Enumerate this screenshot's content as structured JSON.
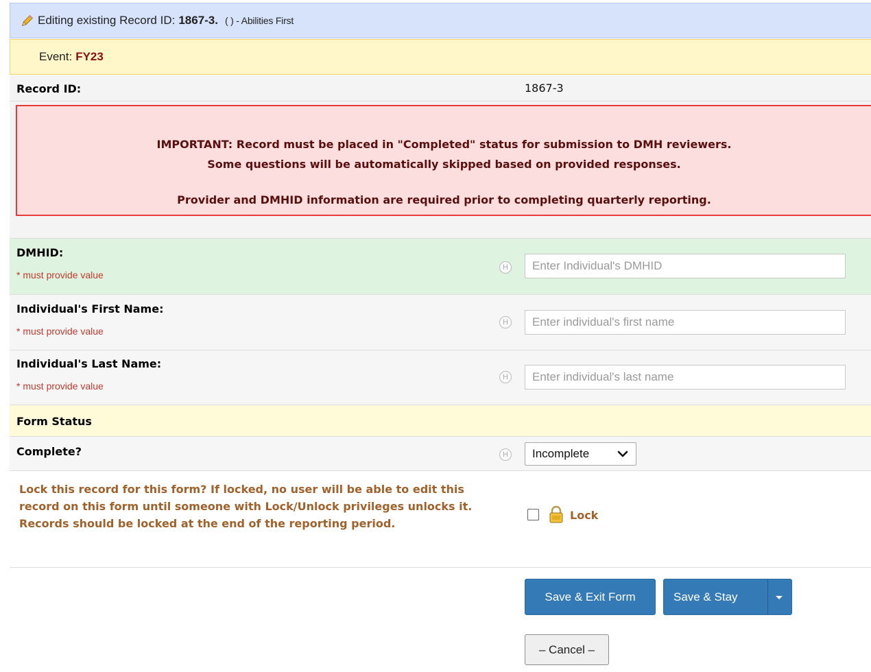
{
  "header": {
    "editing_prefix": "Editing existing Record ID:",
    "record_id": "1867-3.",
    "org_suffix": "( ) - Abilities First",
    "icon": "pencil-icon"
  },
  "event": {
    "label": "Event:",
    "value": "FY23"
  },
  "record_row": {
    "label": "Record ID:",
    "value": "1867-3"
  },
  "alert": {
    "line1": "IMPORTANT: Record must be placed in \"Completed\" status for submission to DMH reviewers.",
    "line2": "Some questions will be automatically skipped based on provided responses.",
    "line3": "Provider and DMHID information are required prior to completing quarterly reporting."
  },
  "fields": [
    {
      "label": "DMHID:",
      "required_note": "* must provide value",
      "placeholder": "Enter Individual's DMHID",
      "help_icon": "H"
    },
    {
      "label": "Individual's First Name:",
      "required_note": "* must provide value",
      "placeholder": "Enter individual's first name",
      "help_icon": "H"
    },
    {
      "label": "Individual's Last Name:",
      "required_note": "* must provide value",
      "placeholder": "Enter individual's last name",
      "help_icon": "H"
    }
  ],
  "form_status": {
    "header": "Form Status",
    "complete_label": "Complete?",
    "help_icon": "H",
    "complete_value": "Incomplete"
  },
  "lock": {
    "text": "Lock this record for this form? If locked, no user will be able to edit this record on this form until someone with Lock/Unlock privileges unlocks it. Records should be locked at the end of the reporting period.",
    "checkbox_label": "Lock",
    "icon": "padlock-icon"
  },
  "buttons": {
    "save_exit": "Save & Exit Form",
    "save_stay": "Save & Stay",
    "cancel": "– Cancel –"
  },
  "colors": {
    "edit_bar": "#d7e3fb",
    "event_bar": "#fff7c9",
    "alert_bg": "#fcdede",
    "alert_border": "#e83a3a",
    "required_green": "#dff3e1",
    "primary_button": "#337ab7",
    "lock_text": "#a0612a"
  }
}
